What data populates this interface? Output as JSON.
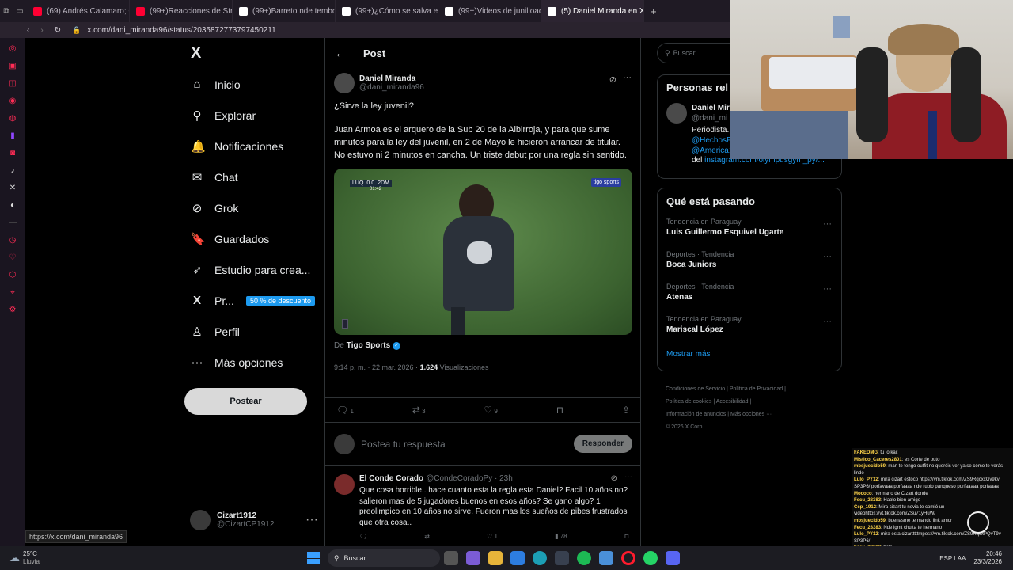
{
  "tabs": [
    {
      "label": "(69) Andrés Calamaro; Cu",
      "color": "#ff0033"
    },
    {
      "label": "(99+)Reacciones de Stre",
      "color": "#ff0033"
    },
    {
      "label": "(99+)Barreto nde tembo",
      "color": "#ffffff"
    },
    {
      "label": "(99+)¿Cómo se salva en",
      "color": "#ffffff"
    },
    {
      "label": "(99+)Videos de junilioaqu",
      "color": "#ffffff"
    },
    {
      "label": "(5) Daniel Miranda en X: \"",
      "color": "#ffffff",
      "active": true
    }
  ],
  "address": {
    "url": "x.com/dani_miranda96/status/2035872773797450211"
  },
  "nav": {
    "logo": "X",
    "items": [
      {
        "label": "Inicio",
        "icon": "home-icon",
        "glyph": "⌂"
      },
      {
        "label": "Explorar",
        "icon": "search-icon",
        "glyph": "⚲"
      },
      {
        "label": "Notificaciones",
        "icon": "bell-icon",
        "glyph": "🔔"
      },
      {
        "label": "Chat",
        "icon": "mail-icon",
        "glyph": "✉"
      },
      {
        "label": "Grok",
        "icon": "grok-icon",
        "glyph": "⊘"
      },
      {
        "label": "Guardados",
        "icon": "bookmark-icon",
        "glyph": "🔖"
      },
      {
        "label": "Estudio para crea...",
        "icon": "rocket-icon",
        "glyph": "➶"
      },
      {
        "label": "Pr...",
        "icon": "x-premium-icon",
        "glyph": "X",
        "badge": "50 % de descuento"
      },
      {
        "label": "Perfil",
        "icon": "person-icon",
        "glyph": "♙"
      },
      {
        "label": "Más opciones",
        "icon": "more-circle-icon",
        "glyph": "⋯"
      }
    ],
    "post_button": "Postear",
    "account": {
      "name": "Cizart1912",
      "handle": "@CizartCP1912"
    }
  },
  "post": {
    "header": "Post",
    "author": "Daniel Miranda",
    "handle": "@dani_miranda96",
    "question": "¿Sirve la ley juvenil?",
    "body": "Juan Armoa es el arquero de la Sub 20 de la Albirroja, y para que sume minutos para la ley del juvenil, en 2 de Mayo le hicieron arrancar de titular. No estuvo ni 2 minutos en cancha. Un triste debut por una regla sin sentido.",
    "video": {
      "score_team1": "LUQ",
      "score": "0 0",
      "team2": "2DM",
      "clock": "01:42",
      "brand": "tigo sports"
    },
    "source_prefix": "De",
    "source": "Tigo Sports",
    "time": "9:14 p. m. · 22 mar. 2026 ·",
    "views": "1.624",
    "views_label": "Visualizaciones",
    "replies": "1",
    "reposts": "3",
    "likes": "9",
    "reply_placeholder": "Postea tu respuesta",
    "reply_button": "Responder"
  },
  "reply": {
    "author": "El Conde Corado",
    "handle": "@CondeCoradoPy · 23h",
    "text": "Que cosa horrible.. hace cuanto esta la regla esta Daniel? Facil 10 años no? salieron mas de 5 jugadores buenos en esos años? Se gano algo? 1 preolimpico en 10 años no sirve. Fueron mas los sueños de pibes frustrados que otra cosa..",
    "replies": "",
    "reposts": "",
    "likes": "1",
    "views": "78"
  },
  "right": {
    "search_placeholder": "Buscar",
    "people_title": "Personas rel",
    "person_name": "Daniel Mir",
    "person_handle": "@dani_mi",
    "person_bio": "Periodista.",
    "person_link1": "@HechosP",
    "person_link2": "@America1",
    "person_del": "del",
    "person_link3": "instagram.com/olympusgym_py/...",
    "trending_title": "Qué está pasando",
    "trends": [
      {
        "context": "Tendencia en Paraguay",
        "name": "Luis Guillermo Esquivel Ugarte"
      },
      {
        "context": "Deportes · Tendencia",
        "name": "Boca Juniors"
      },
      {
        "context": "Deportes · Tendencia",
        "name": "Atenas"
      },
      {
        "context": "Tendencia en Paraguay",
        "name": "Mariscal López"
      }
    ],
    "show_more": "Mostrar más",
    "footer": [
      "Condiciones de Servicio",
      "Política de Privacidad",
      "Política de cookies",
      "Accesibilidad",
      "Información de anuncios",
      "Más opciones ···",
      "© 2026 X Corp."
    ]
  },
  "status_url": "https://x.com/dani_miranda96",
  "chat": [
    {
      "user": "FAKEDMG",
      "text": ": tu lo kai:"
    },
    {
      "user": "Mistico_Caceres2801",
      "text": ": es Corte de puto"
    },
    {
      "user": "mbsjuecido59",
      "text": ": man te tengo outfit no queréis ver ya se cómo te verás lindo"
    },
    {
      "user": "Lulo_PY12",
      "text": ": mira cizart estoco https://vm.tiktok.com/ZS9RqcxxGv9kv SP3P6/ porfavaaa porfaaaa nde rubio panqueso porfaaaaa porfaaaa porfaaaa"
    },
    {
      "user": "Mococo",
      "text": ": hermano de Cizart donde"
    },
    {
      "user": "Fecu_28383",
      "text": ": Hablo bien amigo"
    },
    {
      "user": "Ccp_1912",
      "text": ": Mira cizart tu novia te comió un videohttps://vt.tiktok.com/ZSu71yHuW/"
    },
    {
      "user": "mbsjuecido59",
      "text": ": buenasme te mando link amor"
    },
    {
      "user": "Fecu_28383",
      "text": ": Nde lgmt chuita te hermano"
    },
    {
      "user": "Lulo_PY12",
      "text": ": mira esta cizartttttmpos://vm.tiktok.com/ZS9RqcxPQvT9v SP3P6/"
    },
    {
      "user": "Fecu_28383",
      "text": ": hola"
    }
  ],
  "taskbar": {
    "temp": "25°C",
    "weather": "Lluvia",
    "search": "Buscar",
    "lang": "ESP LAA",
    "time": "20:46",
    "date": "23/3/2026"
  }
}
